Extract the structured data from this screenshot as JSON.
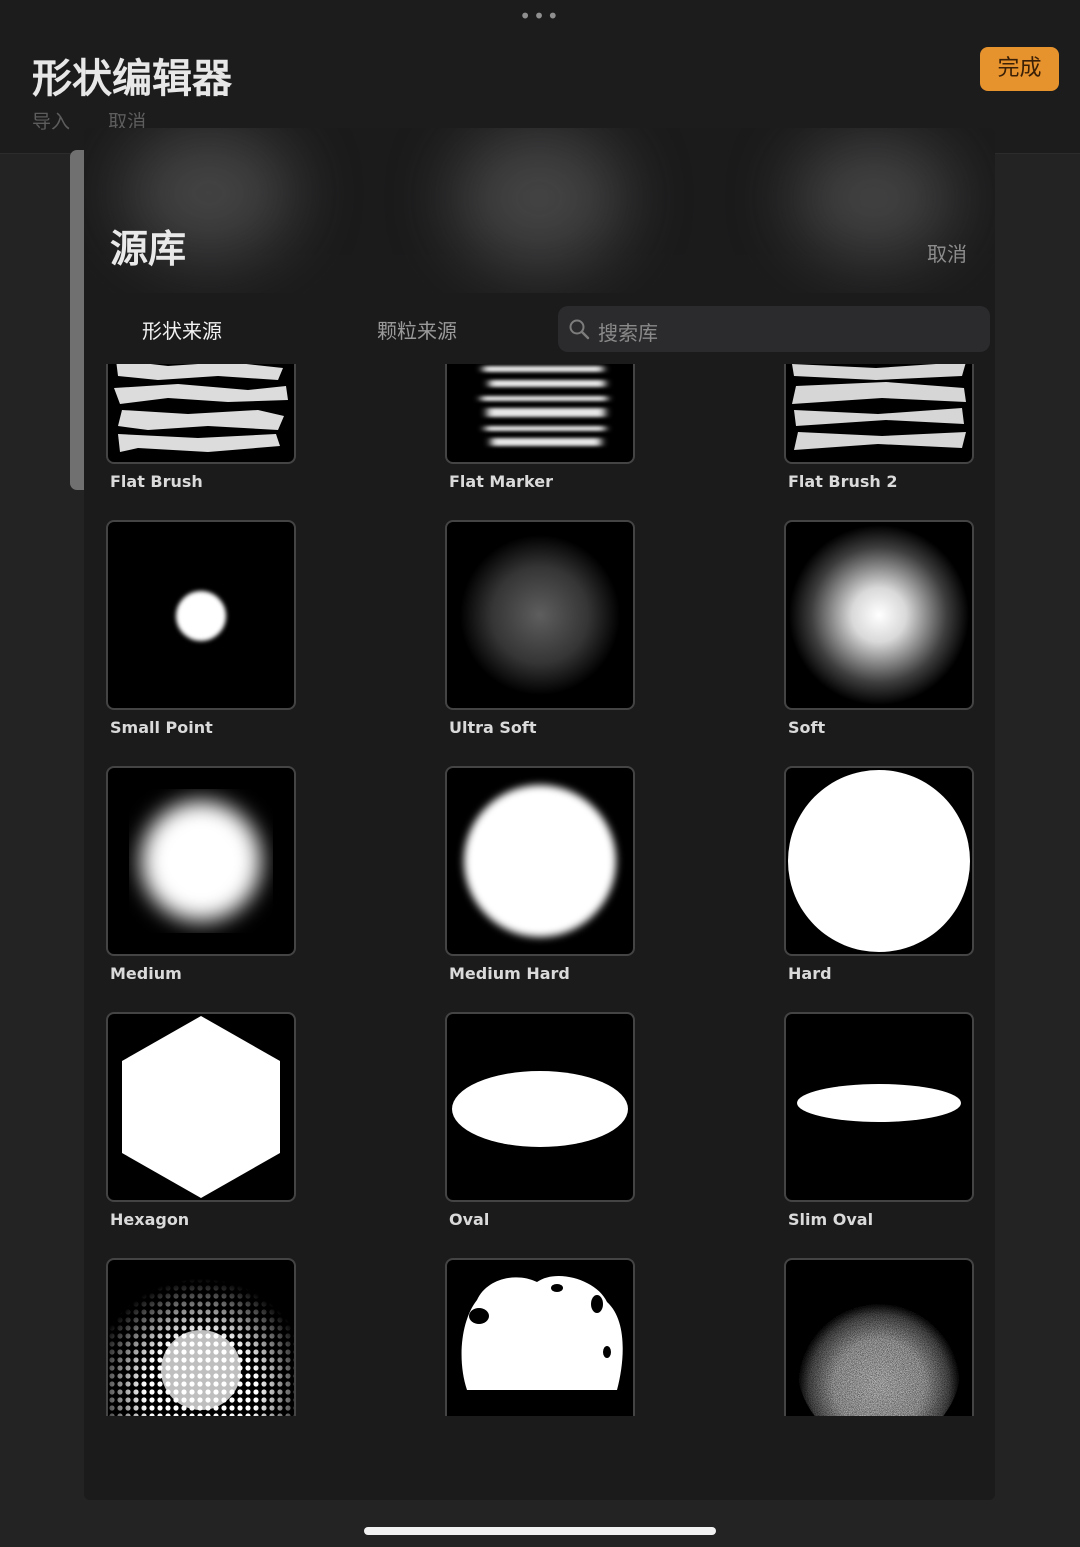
{
  "editor": {
    "title": "形状编辑器",
    "import_label": "导入",
    "cancel_label": "取消",
    "done_label": "完成",
    "accent_color": "#e6922d"
  },
  "source_library": {
    "title": "源库",
    "cancel_label": "取消",
    "tabs": [
      {
        "label": "形状来源",
        "active": true
      },
      {
        "label": "颗粒来源",
        "active": false
      }
    ],
    "search": {
      "placeholder": "搜索库",
      "icon": "search-icon"
    },
    "shapes": [
      {
        "name": "Flat Brush",
        "preview": "flat-brush"
      },
      {
        "name": "Flat Marker",
        "preview": "flat-marker"
      },
      {
        "name": "Flat Brush 2",
        "preview": "flat-brush-2"
      },
      {
        "name": "Small Point",
        "preview": "small-point"
      },
      {
        "name": "Ultra Soft",
        "preview": "ultra-soft"
      },
      {
        "name": "Soft",
        "preview": "soft"
      },
      {
        "name": "Medium",
        "preview": "medium"
      },
      {
        "name": "Medium Hard",
        "preview": "medium-hard"
      },
      {
        "name": "Hard",
        "preview": "hard"
      },
      {
        "name": "Hexagon",
        "preview": "hexagon"
      },
      {
        "name": "Oval",
        "preview": "oval"
      },
      {
        "name": "Slim Oval",
        "preview": "slim-oval"
      },
      {
        "name": "",
        "preview": "halftone"
      },
      {
        "name": "",
        "preview": "blob"
      },
      {
        "name": "",
        "preview": "grainy"
      }
    ]
  }
}
